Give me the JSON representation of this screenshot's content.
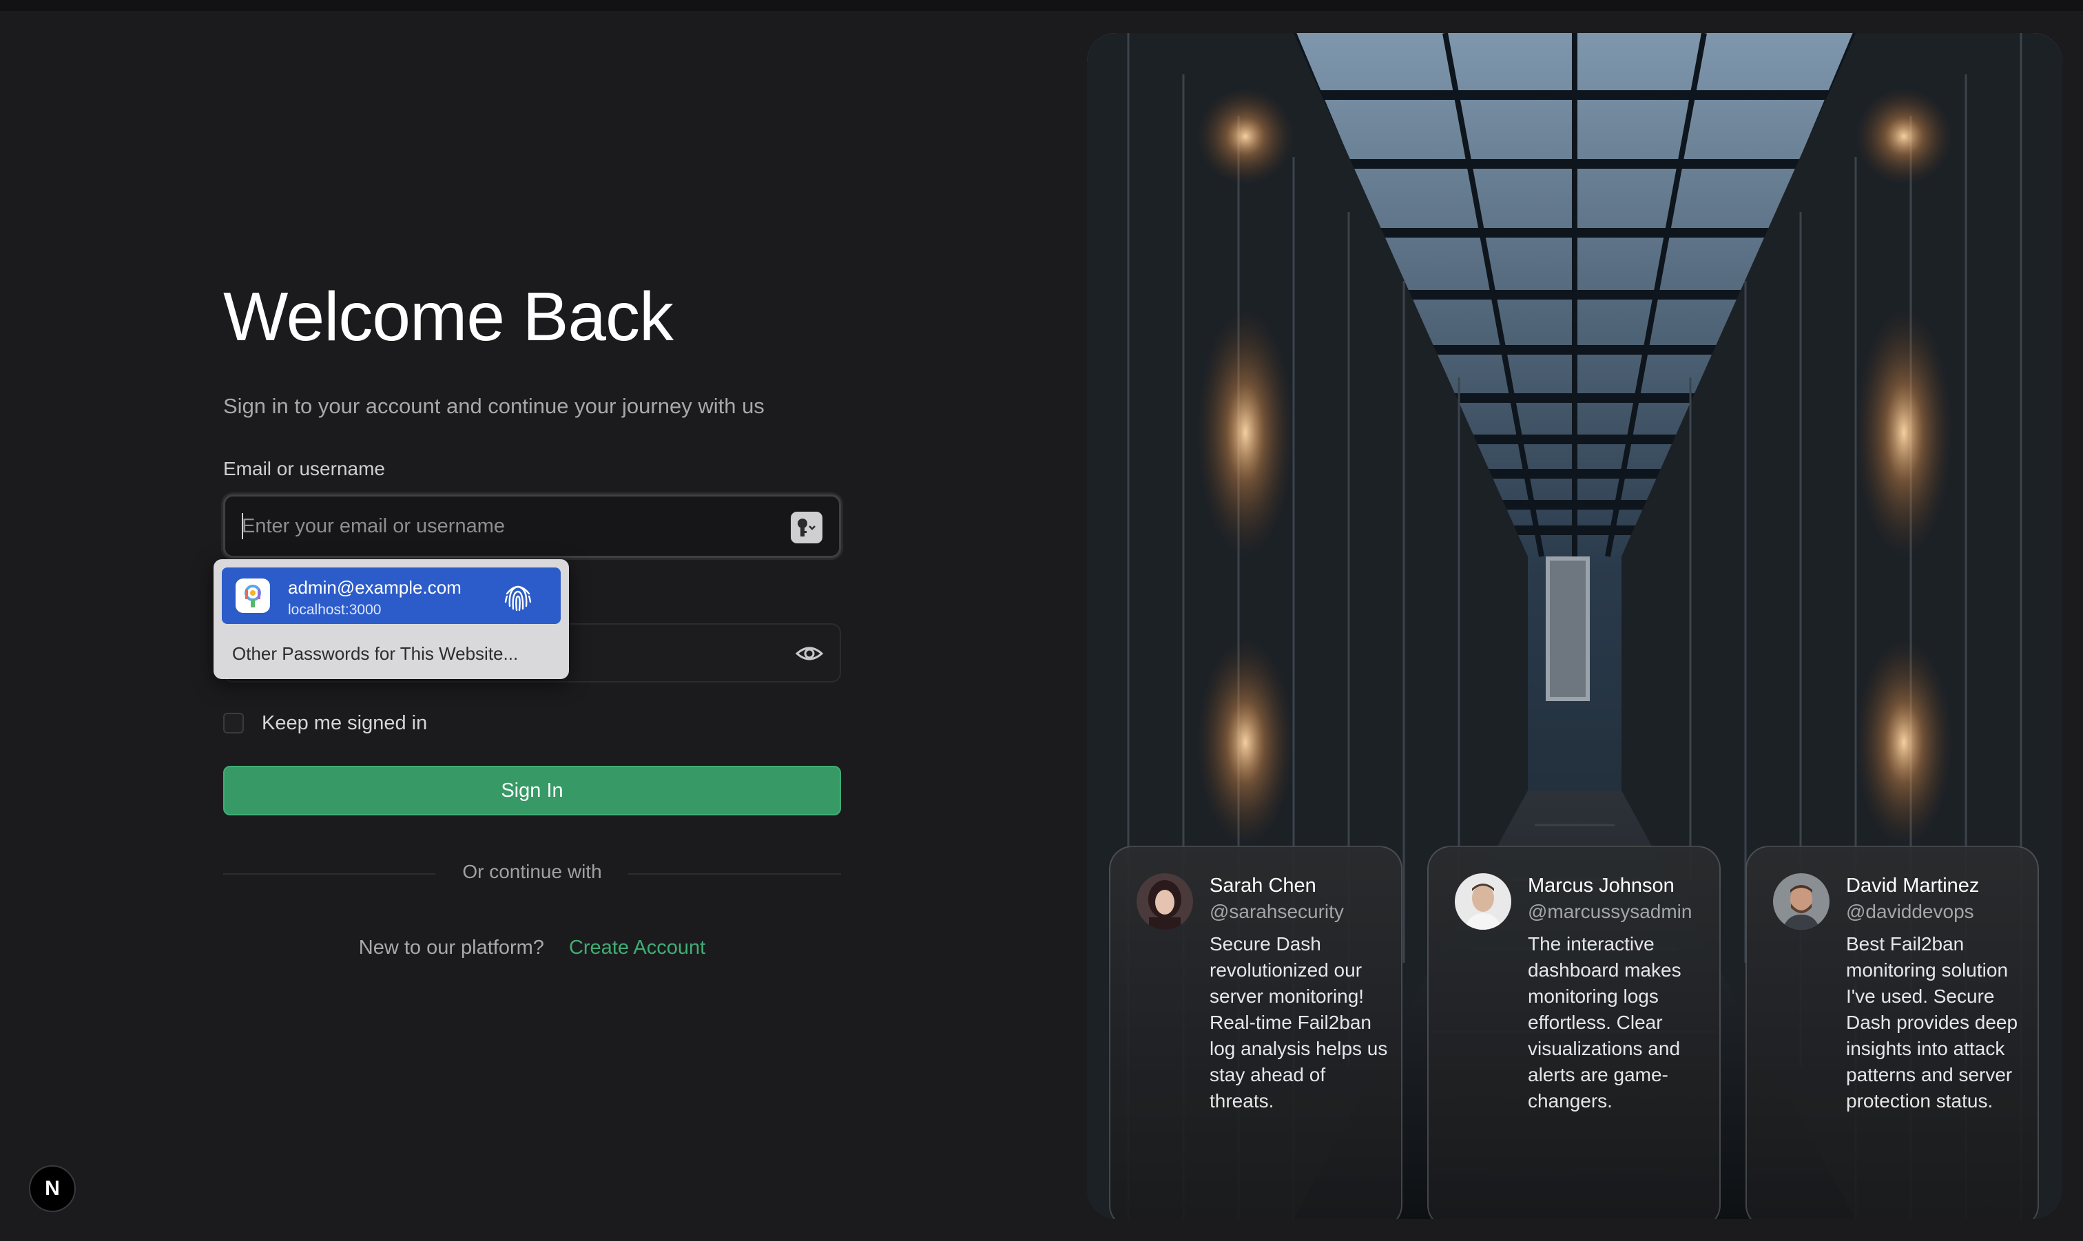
{
  "login": {
    "title": "Welcome Back",
    "subtitle": "Sign in to your account and continue your journey with us",
    "email_label": "Email or username",
    "email_placeholder": "Enter your email or username",
    "remember_label": "Keep me signed in",
    "signin_label": "Sign In",
    "divider_text": "Or continue with",
    "new_user_text": "New to our platform?",
    "create_account_label": "Create Account"
  },
  "autofill": {
    "suggestion_email": "admin@example.com",
    "suggestion_host": "localhost:3000",
    "other_passwords_label": "Other Passwords for This Website..."
  },
  "badge": {
    "label": "N"
  },
  "testimonials": [
    {
      "name": "Sarah Chen",
      "handle": "@sarahsecurity",
      "quote": "Secure Dash revolutionized our server monitoring! Real-time Fail2ban log analysis helps us stay ahead of threats."
    },
    {
      "name": "Marcus Johnson",
      "handle": "@marcussysadmin",
      "quote": "The interactive dashboard makes monitoring logs effortless. Clear visualizations and alerts are game-changers."
    },
    {
      "name": "David Martinez",
      "handle": "@daviddevops",
      "quote": "Best Fail2ban monitoring solution I've used. Secure Dash provides deep insights into attack patterns and server protection status."
    }
  ],
  "colors": {
    "accent": "#369966",
    "link": "#3fae75",
    "background": "#1b1b1d",
    "autofill_highlight": "#2c5cc9"
  },
  "icons": {
    "key": "key-icon",
    "eye": "eye-icon",
    "fingerprint": "fingerprint-icon",
    "passwords_app": "passwords-app-icon"
  }
}
